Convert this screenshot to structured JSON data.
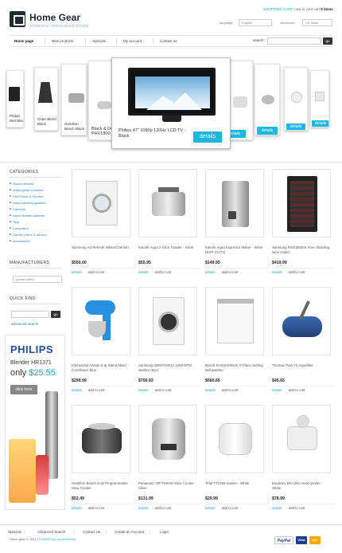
{
  "header": {
    "title": "Home Gear",
    "tagline": "DOMESTIC APPLIANCES STORE",
    "cart_link": "SHOPPING CART:",
    "cart_text": "now in your cart",
    "cart_count": "0 items",
    "language_label": "language:",
    "language_value": "English",
    "currencies_label": "currencies:",
    "currency_value": "US dollar"
  },
  "nav": {
    "items": [
      "Home page",
      "New products",
      "Specials",
      "My account",
      "Contact us"
    ],
    "active_index": 0,
    "search_label": "search:",
    "search_button": "go"
  },
  "carousel": {
    "featured_caption": "Philips 47\" 1080p 120Hz LCD TV - Black",
    "featured_button": "details",
    "left_captions": [
      "Philips Wet Blac",
      "Oster Blend Black",
      "Hamilton Beach Black",
      "Black & De - PHV1800"
    ],
    "right_buttons": [
      "details",
      "details",
      "details",
      "details"
    ]
  },
  "sidebar": {
    "categories_title": "CATEGORIES",
    "categories": [
      "Sound devices",
      "Video game consoles",
      "Cell Phone & Phones",
      "Home security systems",
      "Cameras",
      "Home theater systems",
      "Toys",
      "Computers",
      "Games (Xbox & Wii,etc)",
      "Accessories"
    ],
    "manufacturers_title": "MANUFACTURERS",
    "manufacturers_select": "please select",
    "quickfind_title": "QUICK FIND",
    "quickfind_button": "go",
    "advanced_search": "advanced search"
  },
  "promo": {
    "brand": "PHILIPS",
    "model": "Blender HR1371",
    "price_prefix": "only",
    "price": "$25.55",
    "button": "click here"
  },
  "products": [
    {
      "name": "Samsung Ad Refresh White/Cherrish",
      "price": "$550.00",
      "icon": "washing-machine"
    },
    {
      "name": "Kalorik Aqua 2-Slice Toaster - Silver",
      "price": "$55.95",
      "icon": "toaster"
    },
    {
      "name": "Kalorik Aqua Espresso Maker - Silver (EXP 21773)",
      "price": "$149.95",
      "icon": "espresso-maker"
    },
    {
      "name": "Samsung RW33EBSS Free Standing wine cooler",
      "price": "$419.99",
      "icon": "wine-cooler"
    },
    {
      "name": "KitchenAid Artisan 5-qt Stand Mixer - Cornflower Blue",
      "price": "$299.99",
      "icon": "stand-mixer"
    },
    {
      "name": "Samsung WD8704RJA 1400 RPM washer dryer",
      "price": "$700.83",
      "icon": "washer-dryer"
    },
    {
      "name": "Bosch SHX6AP05UC 5 Place Setting Dishwasher",
      "price": "$560.65",
      "icon": "dishwasher"
    },
    {
      "name": "Thomas Twin T2 Aquafilter",
      "price": "$45.65",
      "icon": "vacuum"
    },
    {
      "name": "Hamilton Beach 6-Qt Programmable Slow Cooker",
      "price": "$52.49",
      "icon": "slow-cooker"
    },
    {
      "name": "Panasonic SR-TMH18 Slow Cooker - Silver",
      "price": "$131.99",
      "icon": "rice-cooker"
    },
    {
      "name": "Tefal TT2465 toaster - White",
      "price": "$29.99",
      "icon": "white-toaster"
    },
    {
      "name": "Moulinex DKA281 meat grinder - White",
      "price": "$78.99",
      "icon": "meat-grinder"
    }
  ],
  "product_actions": {
    "details": "details",
    "add": "add to cart"
  },
  "footer": {
    "links": [
      "Specials",
      "Advanced Search",
      "Contact Us",
      "Create an Account",
      "Login"
    ],
    "copyright_prefix": "Home gear © 2011",
    "powered_by": "Powered by osCommerce",
    "payments": [
      "PayPal",
      "VISA",
      "MC"
    ]
  },
  "colors": {
    "accent": "#1fb6e0",
    "dark": "#1f2a33",
    "link": "#1c7fb5"
  }
}
